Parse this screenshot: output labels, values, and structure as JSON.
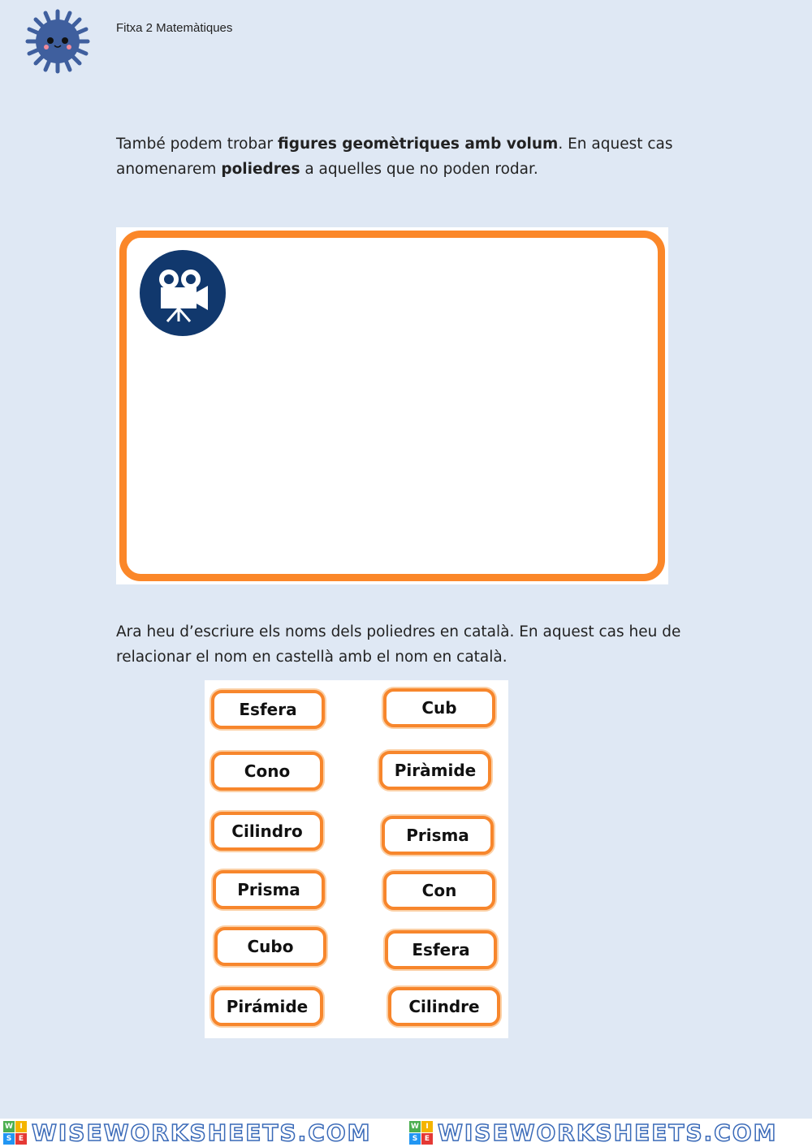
{
  "header": {
    "title": "Fitxa 2 Matemàtiques",
    "logo": "virus-mascot-icon"
  },
  "intro": {
    "t1": "També podem trobar ",
    "b1": "figures geomètriques amb volum",
    "t2": ". En aquest cas anomenarem ",
    "b2": "poliedres",
    "t3": " a aquelles que no poden rodar."
  },
  "video": {
    "icon": "movie-camera-icon",
    "border_color": "#fb8729",
    "icon_bg": "#11386d"
  },
  "instructions": "Ara heu d’escriure els noms dels poliedres en català. En aquest cas heu de relacionar el nom en castellà amb el nom en català.",
  "matching": {
    "left": [
      "Esfera",
      "Cono",
      "Cilindro",
      "Prisma",
      "Cubo",
      "Pirámide"
    ],
    "right": [
      "Cub",
      "Piràmide",
      "Prisma",
      "Con",
      "Esfera",
      "Cilindre"
    ]
  },
  "footer": {
    "watermark": "WISEWORKSHEETS.COM",
    "badge": [
      "W",
      "I",
      "S",
      "E"
    ]
  }
}
